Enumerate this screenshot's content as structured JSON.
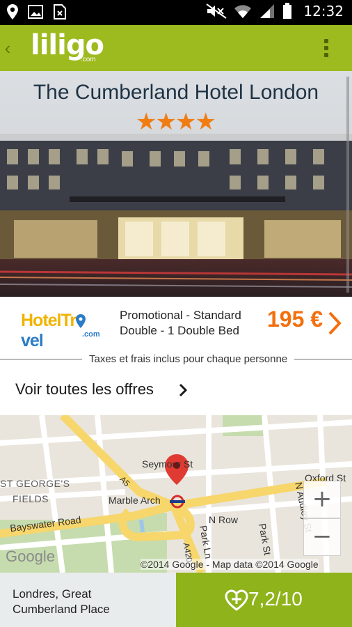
{
  "status_bar": {
    "time": "12:32",
    "icons": [
      "location-icon",
      "image-icon",
      "sim-icon",
      "mute-icon",
      "wifi-icon",
      "signal-icon",
      "battery-icon"
    ]
  },
  "app_bar": {
    "logo_text": "liligo",
    "logo_sub": ".com",
    "brand_color": "#9dbb1f"
  },
  "hotel": {
    "name": "The Cumberland Hotel London",
    "star_count": 4,
    "stars": [
      "★",
      "★",
      "★",
      "★"
    ]
  },
  "offer": {
    "partner_logo_text_a": "HotelTr",
    "partner_logo_text_b": "vel",
    "partner_logo_sub": ".com",
    "description_line1": "Promotional - Standard",
    "description_line2": "Double - 1 Double Bed",
    "price": "195 €",
    "price_color": "#f36f0e"
  },
  "tax_note": "Taxes et frais inclus pour chaque personne",
  "all_offers": {
    "label": "Voir toutes les offres"
  },
  "map": {
    "labels": {
      "seymour": "Seymour St",
      "a5": "A5",
      "st_georges": "ST GEORGE'S",
      "fields": "FIELDS",
      "marble_arch": "Marble Arch",
      "oxford": "Oxford St",
      "bayswater": "Bayswater Road",
      "n_row": "N Row",
      "park_st": "Park St",
      "park_ln": "Park Ln",
      "n_audley": "N Audley St",
      "a420": "A420"
    },
    "zoom_in": "+",
    "zoom_out": "−",
    "google": "Google",
    "copyright": "©2014 Google - Map data ©2014 Google"
  },
  "address": {
    "line1": "Londres, Great",
    "line2": "Cumberland Place"
  },
  "rating": {
    "value": "7,2/10",
    "color": "#8fb31b"
  }
}
